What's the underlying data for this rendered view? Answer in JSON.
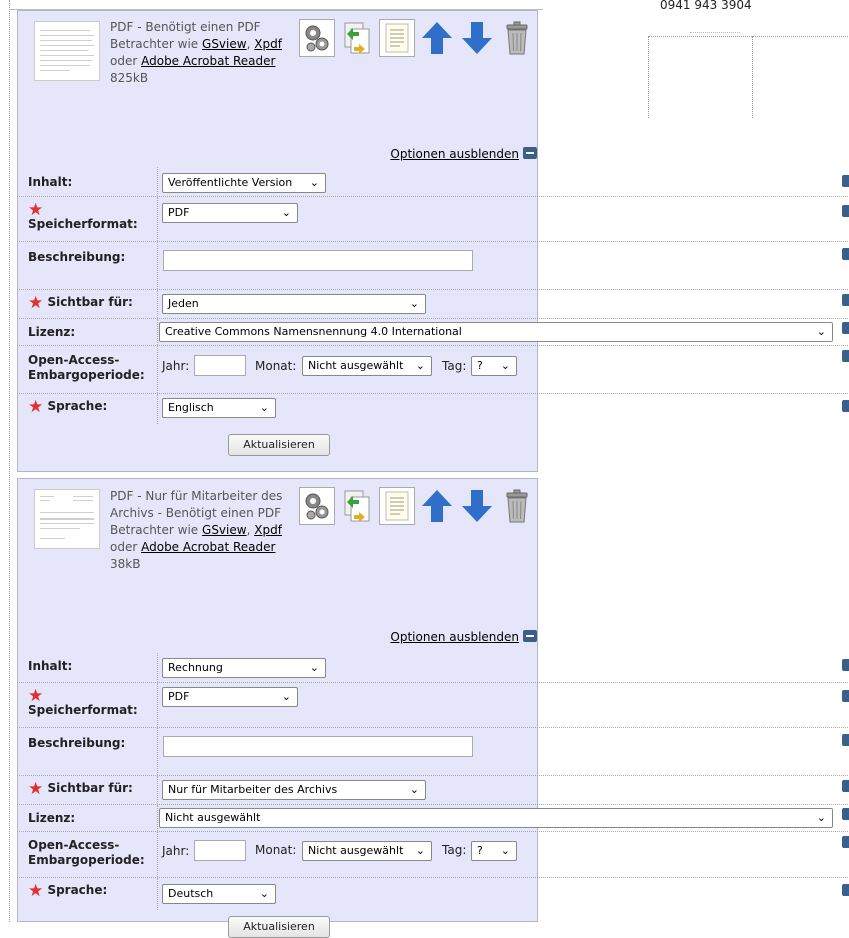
{
  "contact": {
    "phone": "0941 943 3904"
  },
  "files": [
    {
      "description": "PDF - Benötigt einen PDF Betrachter wie",
      "link_gsview": "GSview",
      "sep_comma": ",",
      "link_xpdf": "Xpdf",
      "word_or": "oder",
      "link_acrobat": "Adobe Acrobat Reader",
      "size": "825kB",
      "options_toggle": "Optionen ausblenden",
      "fields": {
        "content_label": "Inhalt:",
        "content_value": "Veröffentlichte Version",
        "format_label": "Speicherformat:",
        "format_value": "PDF",
        "description_label": "Beschreibung:",
        "description_value": "",
        "visible_label": "Sichtbar für:",
        "visible_value": "Jeden",
        "license_label": "Lizenz:",
        "license_value": "Creative Commons Namensnennung 4.0 International",
        "embargo_label": "Open-Access-Embargoperiode:",
        "year_label": "Jahr:",
        "year_value": "",
        "month_label": "Monat:",
        "month_value": "Nicht ausgewählt",
        "day_label": "Tag:",
        "day_value": "?",
        "language_label": "Sprache:",
        "language_value": "Englisch"
      },
      "update_button": "Aktualisieren"
    },
    {
      "description": "PDF - Nur für Mitarbeiter des Archivs - Benötigt einen PDF Betrachter wie",
      "link_gsview": "GSview",
      "sep_comma": ",",
      "link_xpdf": "Xpdf",
      "word_or": "oder",
      "link_acrobat": "Adobe Acrobat Reader",
      "size": "38kB",
      "options_toggle": "Optionen ausblenden",
      "fields": {
        "content_label": "Inhalt:",
        "content_value": "Rechnung",
        "format_label": "Speicherformat:",
        "format_value": "PDF",
        "description_label": "Beschreibung:",
        "description_value": "",
        "visible_label": "Sichtbar für:",
        "visible_value": "Nur für Mitarbeiter des Archivs",
        "license_label": "Lizenz:",
        "license_value": "Nicht ausgewählt",
        "embargo_label": "Open-Access-Embargoperiode:",
        "year_label": "Jahr:",
        "year_value": "",
        "month_label": "Monat:",
        "month_value": "Nicht ausgewählt",
        "day_label": "Tag:",
        "day_value": "?",
        "language_label": "Sprache:",
        "language_value": "Deutsch"
      },
      "update_button": "Aktualisieren"
    }
  ],
  "icons": [
    "gears-icon",
    "convert-icon",
    "details-icon",
    "move-up-icon",
    "move-down-icon",
    "delete-icon",
    "help-icon"
  ],
  "colors": {
    "panel_bg": "#e6e6fa",
    "required_star": "#e03030",
    "arrow_blue": "#2f6fc7"
  }
}
